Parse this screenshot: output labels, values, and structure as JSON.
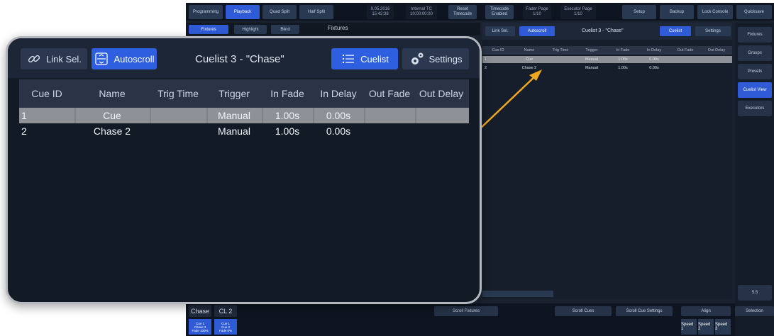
{
  "console": {
    "topbar": [
      {
        "label": "Programming",
        "selected": false
      },
      {
        "label": "Playback",
        "selected": true
      },
      {
        "label": "Quad Split",
        "selected": false
      },
      {
        "label": "Half Split",
        "selected": false
      },
      {
        "label": "9.05.2016 15:42:38",
        "selected": false,
        "dark": true
      },
      {
        "label": "Internal TC 10:00:00:00",
        "selected": false,
        "dark": true
      },
      {
        "label": "Reset Timecode",
        "selected": false
      },
      {
        "label": "Timecode Enabled",
        "selected": false
      },
      {
        "label": "Fader Page 1/10",
        "selected": false,
        "dark": true
      },
      {
        "label": "Executor Page 1/10",
        "selected": false,
        "dark": true
      },
      {
        "label": "Setup",
        "selected": false
      },
      {
        "label": "Backup",
        "selected": false
      },
      {
        "label": "Lock Console",
        "selected": false
      },
      {
        "label": "Quicksave",
        "selected": false
      }
    ],
    "subbar": {
      "fixtures_tab": "Fixtures",
      "highlight": "Highlight",
      "blind": "Blind",
      "fixtures_label": "Fixtures"
    },
    "cuelist_small": {
      "link_sel": "Link Sel.",
      "autoscroll": "Autoscroll",
      "title": "Cuelist 3 - \"Chase\"",
      "cuelist": "Cuelist",
      "settings": "Settings",
      "columns": [
        "Cue ID",
        "Name",
        "Trig Time",
        "Trigger",
        "In Fade",
        "In Delay",
        "Out Fade",
        "Out Delay"
      ],
      "rows": [
        [
          "1",
          "Cue",
          "",
          "Manual",
          "1.00s",
          "0.00s",
          "",
          ""
        ],
        [
          "2",
          "Chase 2",
          "",
          "Manual",
          "1.00s",
          "0.00s",
          "",
          ""
        ]
      ]
    },
    "right_column": [
      {
        "label": "Fixtures",
        "selected": false
      },
      {
        "label": "Groups",
        "selected": false
      },
      {
        "label": "Presets",
        "selected": false
      },
      {
        "label": "Cuelist View",
        "selected": true
      },
      {
        "label": "Executors",
        "selected": false
      },
      {
        "label": "5.5",
        "selected": false
      }
    ],
    "bottombar": {
      "exec1": "Chase",
      "exec2": "CL 2",
      "cue1_lines": [
        "Cue 1",
        "Chase 2",
        "Fade 100%"
      ],
      "cue2_lines": [
        "Cue 1",
        "Cue 2",
        "Fade 0%"
      ],
      "scroll_fixtures": "Scroll Fixtures",
      "scroll_cues": "Scroll Cues",
      "scroll_cue_settings": "Scroll Cue Settings",
      "align": "Align",
      "selection": "Selection",
      "speed1": "Speed 1",
      "speed2": "Speed 2",
      "speed3": "Speed 3"
    }
  },
  "popup": {
    "link_sel": "Link Sel.",
    "autoscroll": "Autoscroll",
    "title": "Cuelist 3 - \"Chase\"",
    "cuelist": "Cuelist",
    "settings": "Settings",
    "columns": [
      "Cue ID",
      "Name",
      "Trig Time",
      "Trigger",
      "In Fade",
      "In Delay",
      "Out Fade",
      "Out Delay"
    ],
    "rows": [
      {
        "cue_id": "1",
        "name": "Cue",
        "trig_time": "",
        "trigger": "Manual",
        "in_fade": "1.00s",
        "in_delay": "0.00s",
        "out_fade": "",
        "out_delay": "",
        "highlighted": true
      },
      {
        "cue_id": "2",
        "name": "Chase 2",
        "trig_time": "",
        "trigger": "Manual",
        "in_fade": "1.00s",
        "in_delay": "0.00s",
        "out_fade": "",
        "out_delay": "",
        "highlighted": false
      }
    ]
  },
  "colors": {
    "accent_blue": "#2e5fe0",
    "highlight_row": "#8e9197",
    "arrow": "#f0a81e",
    "popup_border": "#b5b9bf"
  }
}
